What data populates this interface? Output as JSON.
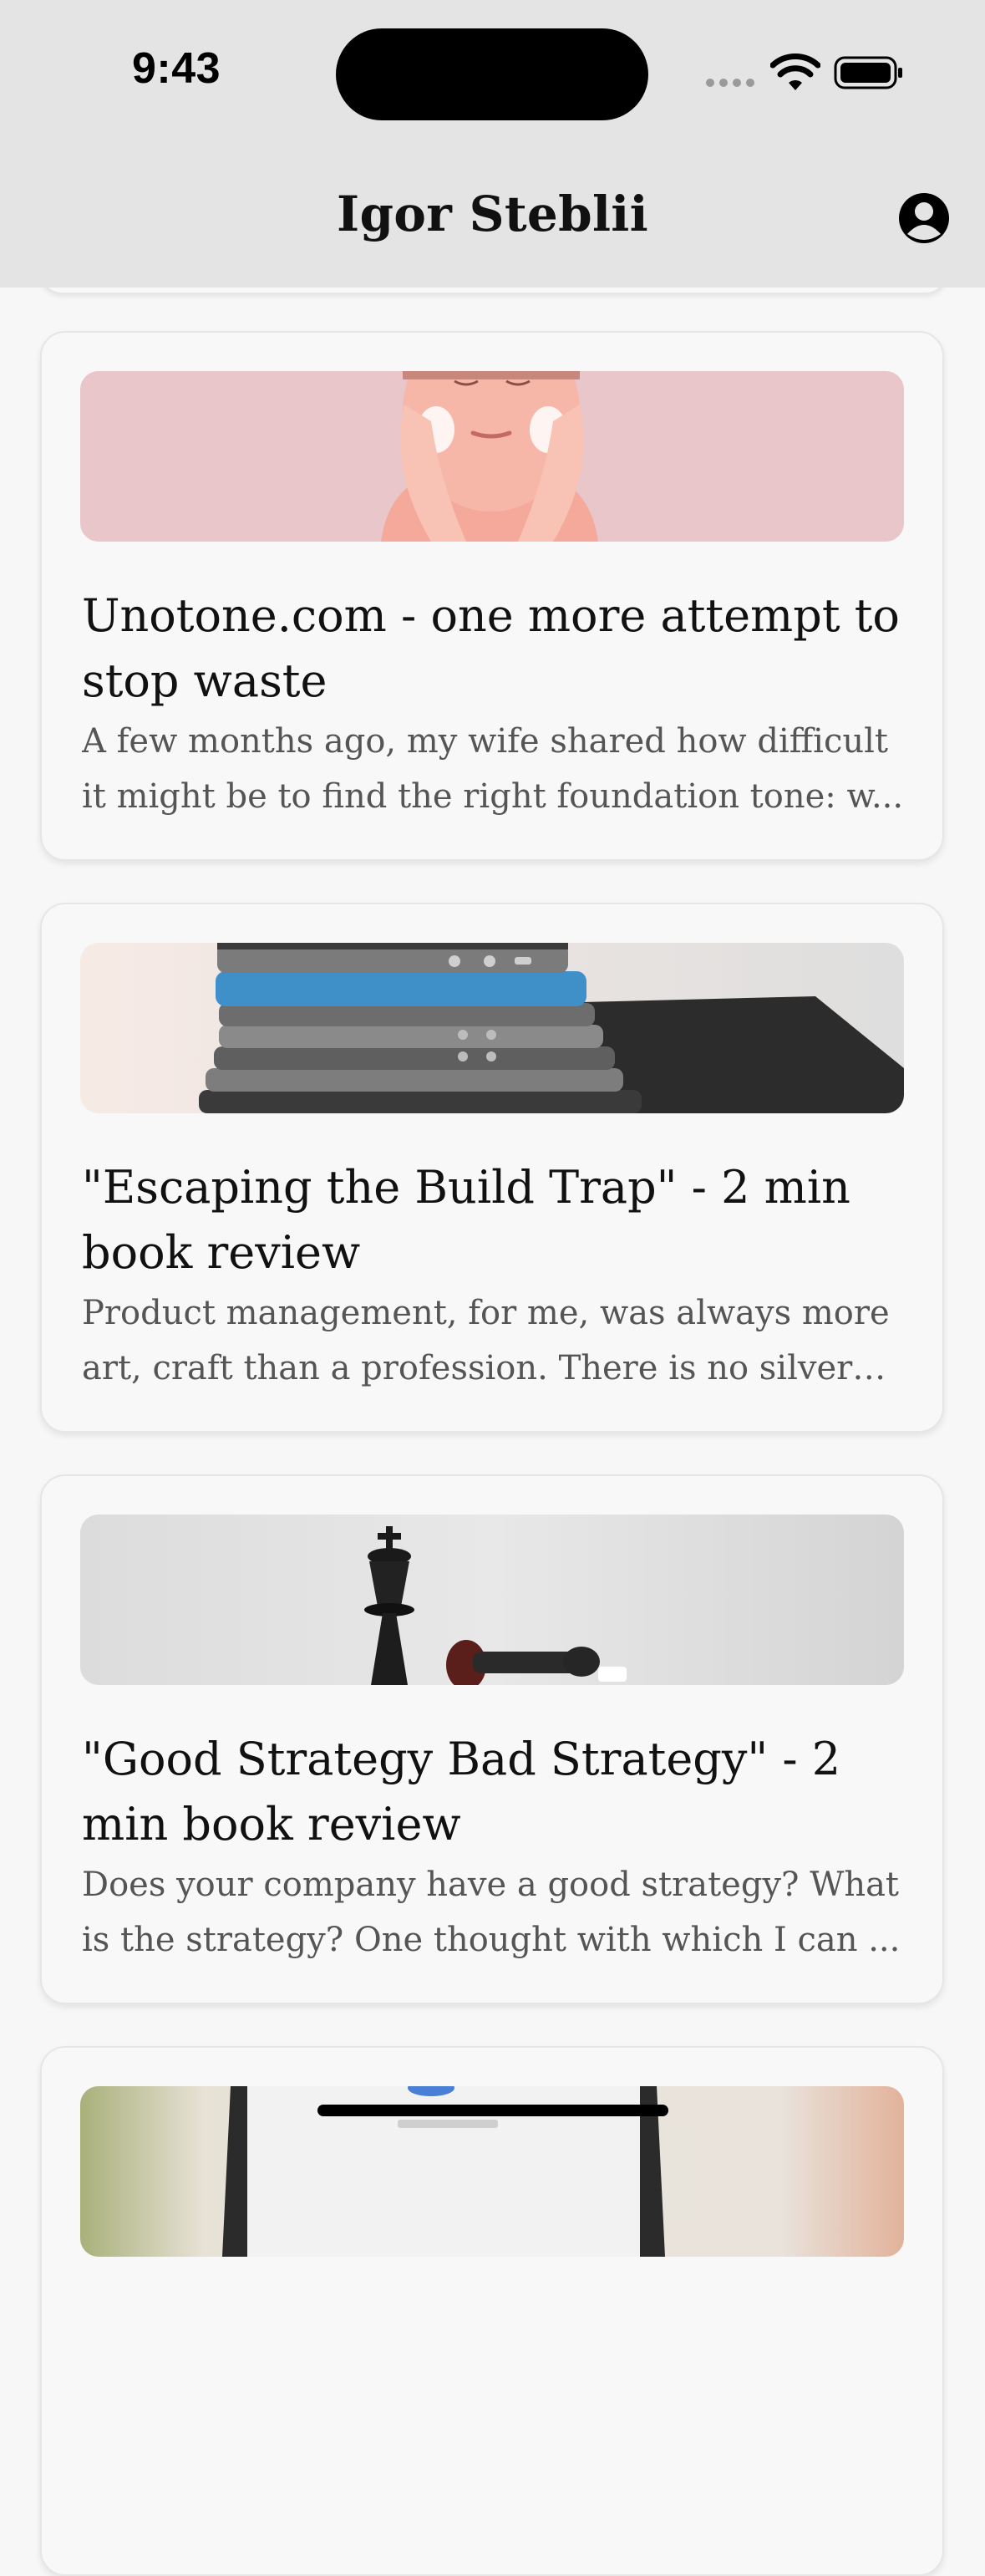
{
  "status_bar": {
    "time": "9:43"
  },
  "header": {
    "title": "Igor Steblii",
    "profile_icon": "person-circle-icon"
  },
  "posts": [
    {
      "title": "Unotone.com - one more attempt to stop waste",
      "excerpt": "A few months ago, my wife shared how difficult it might be to find the right foundation tone: w..."
    },
    {
      "title": "\"Escaping the Build Trap\" - 2 min book review",
      "excerpt": "Product management, for me, was always more art, craft than a profession. There is no silver b..."
    },
    {
      "title": "\"Good Strategy Bad Strategy\" - 2 min book review",
      "excerpt": "Does your company have a good strategy? What is the strategy? One thought with which I can ..."
    }
  ],
  "colors": {
    "header_bg": "#e4e4e4",
    "page_bg": "#f7f7f7",
    "card_bg": "#f8f8f8",
    "title_text": "#111111",
    "excerpt_text": "#555555"
  }
}
